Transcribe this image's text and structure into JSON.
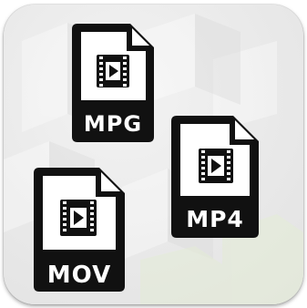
{
  "files": [
    {
      "name": "mpg-file",
      "label": "MPG"
    },
    {
      "name": "mp4-file",
      "label": "MP4"
    },
    {
      "name": "mov-file",
      "label": "MOV"
    }
  ],
  "colors": {
    "icon_fill": "#111111",
    "background": "#eaeaea",
    "label_text": "#ffffff"
  },
  "icons": {
    "document": "video-file-icon",
    "media": "film-play-icon"
  }
}
